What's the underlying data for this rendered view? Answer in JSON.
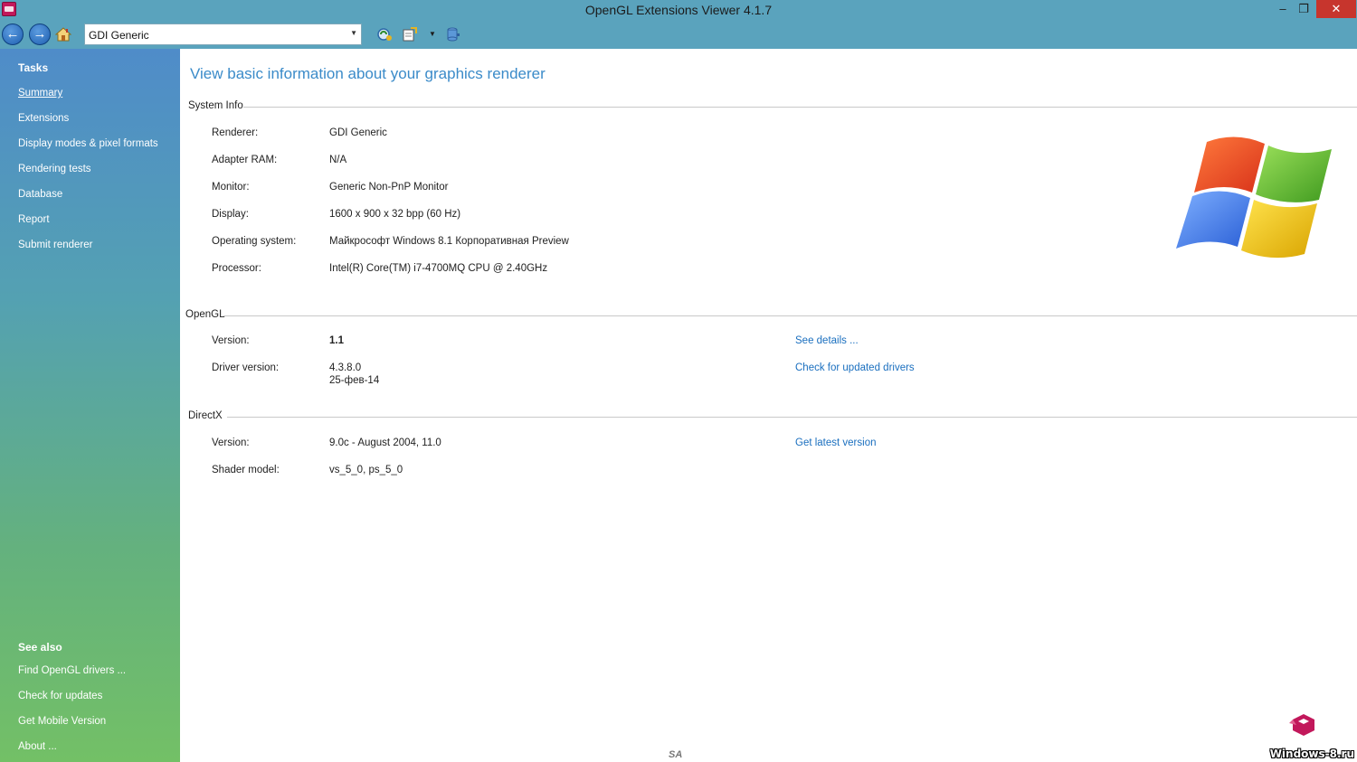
{
  "window": {
    "title": "OpenGL Extensions Viewer 4.1.7",
    "minimize_glyph": "‒",
    "maximize_glyph": "❐",
    "close_glyph": "✕"
  },
  "toolbar": {
    "back_glyph": "←",
    "forward_glyph": "→",
    "renderer_select": {
      "value": "GDI Generic"
    },
    "dropdown_glyph": "▼",
    "icons": [
      "back-icon",
      "forward-icon",
      "home-icon",
      "refresh-icon",
      "export-icon",
      "database-icon"
    ]
  },
  "sidebar": {
    "tasks_heading": "Tasks",
    "tasks": [
      {
        "label": "Summary",
        "active": true
      },
      {
        "label": "Extensions"
      },
      {
        "label": "Display modes & pixel formats"
      },
      {
        "label": "Rendering tests"
      },
      {
        "label": "Database"
      },
      {
        "label": "Report"
      },
      {
        "label": "Submit renderer"
      }
    ],
    "see_also_heading": "See also",
    "see_also": [
      {
        "label": "Find OpenGL drivers ..."
      },
      {
        "label": "Check for updates"
      },
      {
        "label": "Get Mobile Version"
      },
      {
        "label": "About ..."
      }
    ]
  },
  "main": {
    "title": "View basic information about your graphics renderer",
    "system_info": {
      "header": "System Info",
      "rows": [
        {
          "label": "Renderer:",
          "value": "GDI Generic"
        },
        {
          "label": "Adapter RAM:",
          "value": "N/A"
        },
        {
          "label": "Monitor:",
          "value": "Generic Non-PnP Monitor"
        },
        {
          "label": "Display:",
          "value": "1600 x 900 x 32 bpp (60 Hz)"
        },
        {
          "label": "Operating system:",
          "value": "Майкрософт Windows 8.1 Корпоративная Preview"
        },
        {
          "label": "Processor:",
          "value": "Intel(R) Core(TM) i7-4700MQ CPU @ 2.40GHz"
        }
      ]
    },
    "opengl": {
      "header": "OpenGL",
      "version_label": "Version:",
      "version_value": "1.1",
      "version_link": "See details ...",
      "driver_label": "Driver version:",
      "driver_value": "4.3.8.0",
      "driver_date": "25-фев-14",
      "driver_link": "Check for updated drivers"
    },
    "directx": {
      "header": "DirectX",
      "version_label": "Version:",
      "version_value": "9.0c - August 2004, 11.0",
      "version_link": "Get latest version",
      "shader_label": "Shader model:",
      "shader_value": "vs_5_0, ps_5_0"
    }
  },
  "watermark": "Windows-8.ru",
  "colors": {
    "titlebar": "#5aa3bd",
    "close_button": "#c7352d",
    "link": "#1a6fbf",
    "page_title": "#3b8bc9"
  }
}
